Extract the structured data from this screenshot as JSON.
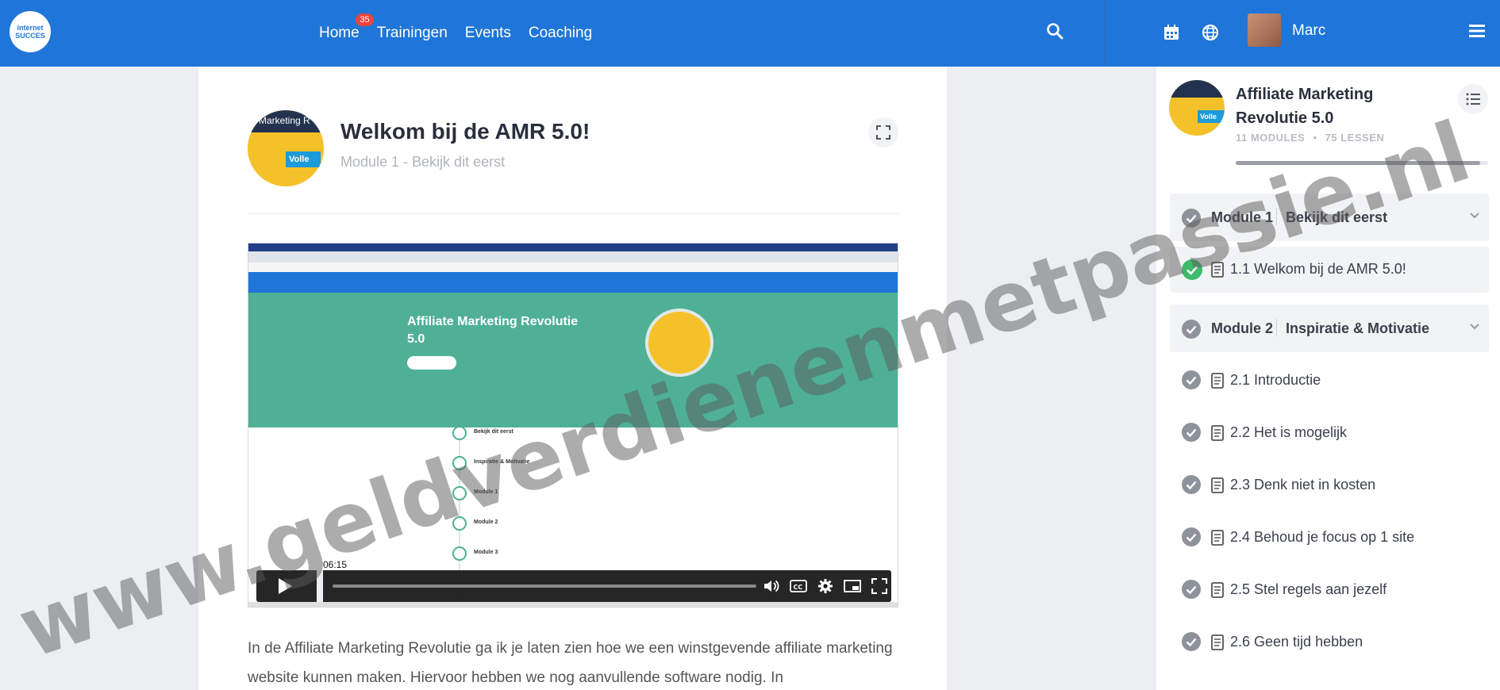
{
  "header": {
    "logo_line1": "internet",
    "logo_line2": "SUCCES",
    "nav": [
      {
        "label": "Home",
        "badge": "35"
      },
      {
        "label": "Trainingen"
      },
      {
        "label": "Events"
      },
      {
        "label": "Coaching"
      }
    ],
    "user_name": "Marc",
    "icons": [
      "search-icon",
      "calendar-icon",
      "globe-icon",
      "hamburger-menu-icon"
    ],
    "accent_color": "#1f76d8"
  },
  "lesson": {
    "title": "Welkom bij de AMR 5.0!",
    "subtitle": "Module 1 - Bekijk dit eerst",
    "thumb_text": "Marketing R",
    "thumb_pill": "Volle"
  },
  "video": {
    "hero_title": "Affiliate Marketing Revolutie 5.0",
    "time_tooltip": "06:15",
    "steps": [
      "Bekijk dit eerst",
      "Inspiratie & Motivatie",
      "Module 1",
      "Module 2",
      "Module 3"
    ]
  },
  "body_text": "In de Affiliate Marketing Revolutie ga ik je laten zien hoe we een winstgevende affiliate marketing website kunnen maken. Hiervoor hebben we nog aanvullende software nodig. In",
  "sidebar": {
    "course_title": "Affiliate Marketing Revolutie 5.0",
    "meta_modules": "11 MODULES",
    "meta_sep": "•",
    "meta_lessons": "75 LESSEN",
    "progress_fraction": 0.97,
    "thumb_pill": "Volle",
    "thumb_text": "Marketing R",
    "modules": [
      {
        "number": "Module 1",
        "name": "Bekijk dit eerst",
        "lessons": [
          {
            "label": "1.1 Welkom bij de AMR 5.0!",
            "completed": true,
            "active": true
          }
        ]
      },
      {
        "number": "Module 2",
        "name": "Inspiratie & Motivatie",
        "lessons": [
          {
            "label": "2.1 Introductie"
          },
          {
            "label": "2.2 Het is mogelijk"
          },
          {
            "label": "2.3 Denk niet in kosten"
          },
          {
            "label": "2.4 Behoud je focus op 1 site"
          },
          {
            "label": "2.5 Stel regels aan jezelf"
          },
          {
            "label": "2.6 Geen tijd hebben"
          }
        ]
      }
    ]
  },
  "watermark": "www.geldverdienenmetpassie.nl"
}
